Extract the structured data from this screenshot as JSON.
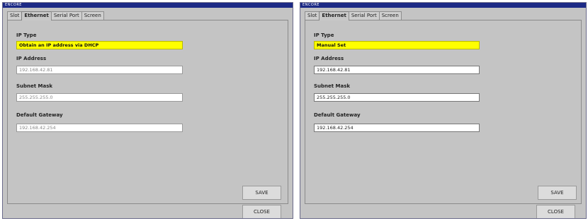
{
  "left_window": {
    "title": "ENCORE",
    "tabs": [
      "Slot",
      "Ethernet",
      "Serial Port",
      "Screen"
    ],
    "active_tab": "Ethernet",
    "ip_type_label": "IP Type",
    "ip_type_value": "Obtain an IP address via DHCP",
    "ip_address_label": "IP Address",
    "ip_address_value": "192.168.42.81",
    "subnet_label": "Subnet Mask",
    "subnet_value": "255.255.255.0",
    "gateway_label": "Default Gateway",
    "gateway_value": "192.168.42.254",
    "save_label": "SAVE",
    "close_label": "CLOSE"
  },
  "right_window": {
    "title": "ENCORE",
    "tabs": [
      "Slot",
      "Ethernet",
      "Serial Port",
      "Screen"
    ],
    "active_tab": "Ethernet",
    "ip_type_label": "IP Type",
    "ip_type_value": "Manual Set",
    "ip_address_label": "IP Address",
    "ip_address_value": "192.168.42.81",
    "subnet_label": "Subnet Mask",
    "subnet_value": "255.255.255.0",
    "gateway_label": "Default Gateway",
    "gateway_value": "192.168.42.254",
    "save_label": "SAVE",
    "close_label": "CLOSE"
  },
  "colors": {
    "title_bar": "#1c2a86",
    "dialog_bg": "#c4c4c4",
    "selected_field": "#ffff00"
  }
}
